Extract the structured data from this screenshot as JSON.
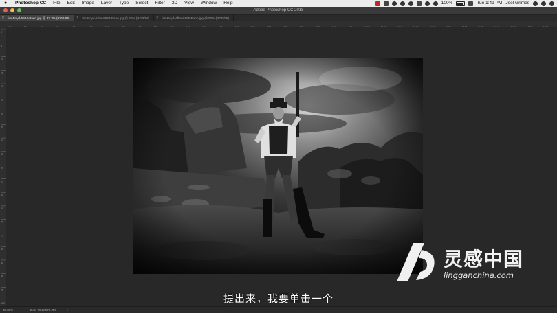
{
  "menubar": {
    "app_name": "Photoshop CC",
    "items": [
      "File",
      "Edit",
      "Image",
      "Layer",
      "Type",
      "Select",
      "Filter",
      "3D",
      "View",
      "Window",
      "Help"
    ],
    "battery": "100%",
    "clock": "Tue 1:49 PM",
    "user": "Joel Grimes"
  },
  "window": {
    "title": "Adobe Photoshop CC 2018"
  },
  "tabs": [
    {
      "label": "Jim-Boyd-5944-Pano.jpg @ 33.3% (RGB/8#)",
      "active": true
    },
    {
      "label": "Jim-Boyd-After-5963-Pano.jpg @ 50% (RGB/8#)",
      "active": false
    },
    {
      "label": "Jim-Boyd-After-5995-Pano.jpg @ 50% (RGB/8#)",
      "active": false
    }
  ],
  "rulers": {
    "top": [
      "10",
      "5",
      "0",
      "5",
      "10",
      "15",
      "20",
      "25",
      "30",
      "35",
      "40",
      "45",
      "50",
      "55",
      "60",
      "65",
      "70",
      "75",
      "80",
      "85",
      "90",
      "95",
      "100",
      "105",
      "110",
      "115",
      "120",
      "125",
      "130",
      "135",
      "140",
      "145",
      "150",
      "155"
    ],
    "left": [
      "0",
      "5",
      "10",
      "15",
      "20",
      "25",
      "30",
      "35",
      "40",
      "45",
      "50",
      "55",
      "60",
      "65",
      "70",
      "75",
      "80",
      "85",
      "90",
      "95",
      "100"
    ]
  },
  "status": {
    "zoom": "33.33%",
    "doc": "Doc: 76.2M/76.2M",
    "arrow": "›"
  },
  "subtitle": "提出来，我要单击一个",
  "watermark": {
    "name": "灵感中国",
    "url": "lingganchina.com"
  },
  "colors": {
    "close": "#ec5f57",
    "minimize": "#f4bd4f",
    "zoom": "#5fc553"
  }
}
